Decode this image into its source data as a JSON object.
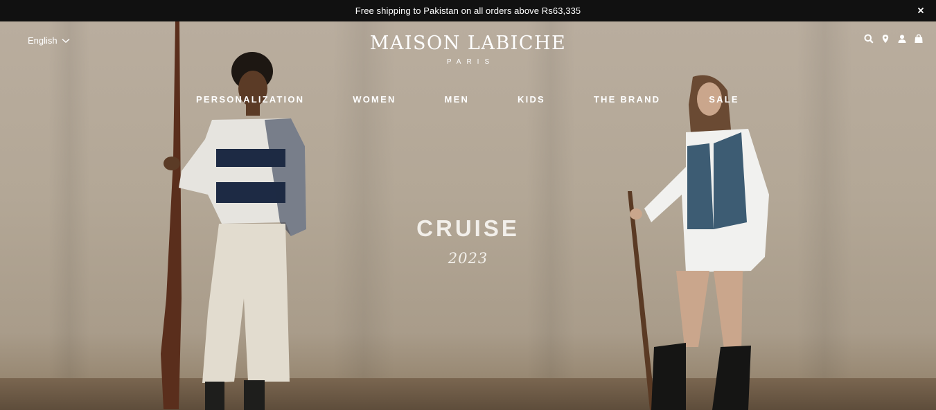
{
  "announcement": {
    "text": "Free shipping to Pakistan on all orders above Rs63,335",
    "close_icon": "close-icon"
  },
  "header": {
    "language": "English",
    "logo": {
      "name": "MAISON LABICHE",
      "subtitle": "PARIS"
    },
    "icons": [
      "search-icon",
      "map-pin-icon",
      "user-icon",
      "shopping-bag-icon"
    ]
  },
  "nav": {
    "items": [
      {
        "label": "PERSONALIZATION"
      },
      {
        "label": "WOMEN"
      },
      {
        "label": "MEN"
      },
      {
        "label": "KIDS"
      },
      {
        "label": "THE BRAND"
      },
      {
        "label": "SALE"
      }
    ]
  },
  "hero": {
    "title": "CRUISE",
    "subtitle": "2023"
  },
  "colors": {
    "announcement_bg": "#111111",
    "hero_bg": "#b3a796",
    "text_light": "#ffffff"
  }
}
